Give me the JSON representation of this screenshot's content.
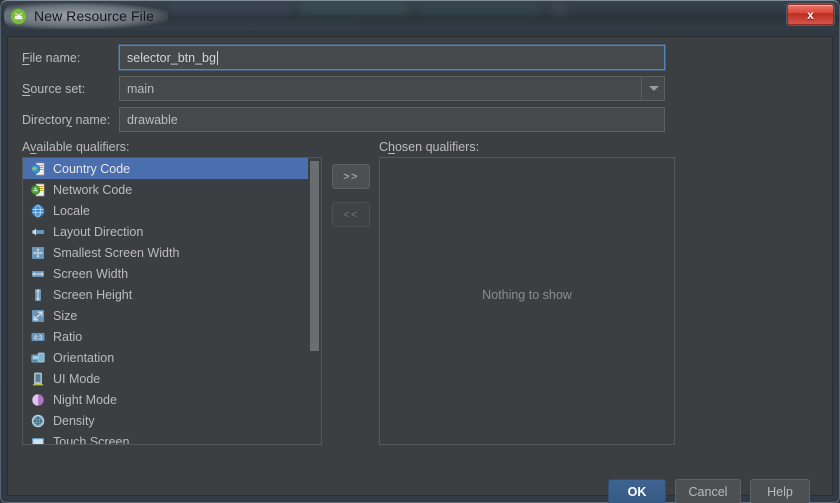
{
  "window": {
    "title": "New Resource File",
    "app_icon": "android-studio-icon",
    "close_label": "x"
  },
  "form": {
    "file_name": {
      "label": "File name:",
      "mnemonic": "F",
      "value": "selector_btn_bg",
      "placeholder": ""
    },
    "source_set": {
      "label": "Source set:",
      "mnemonic": "S",
      "value": "main",
      "options": [
        "main"
      ]
    },
    "directory_name": {
      "label": "Directory name:",
      "mnemonic": "y",
      "value": "drawable",
      "placeholder": ""
    }
  },
  "available": {
    "label": "Available qualifiers:",
    "mnemonic": "v",
    "items": [
      {
        "label": "Country Code",
        "icon": "country-code-icon",
        "selected": true
      },
      {
        "label": "Network Code",
        "icon": "network-code-icon",
        "selected": false
      },
      {
        "label": "Locale",
        "icon": "locale-globe-icon",
        "selected": false
      },
      {
        "label": "Layout Direction",
        "icon": "layout-direction-icon",
        "selected": false
      },
      {
        "label": "Smallest Screen Width",
        "icon": "smallest-screen-width-icon",
        "selected": false
      },
      {
        "label": "Screen Width",
        "icon": "screen-width-icon",
        "selected": false
      },
      {
        "label": "Screen Height",
        "icon": "screen-height-icon",
        "selected": false
      },
      {
        "label": "Size",
        "icon": "size-icon",
        "selected": false
      },
      {
        "label": "Ratio",
        "icon": "ratio-icon",
        "selected": false
      },
      {
        "label": "Orientation",
        "icon": "orientation-icon",
        "selected": false
      },
      {
        "label": "UI Mode",
        "icon": "ui-mode-icon",
        "selected": false
      },
      {
        "label": "Night Mode",
        "icon": "night-mode-icon",
        "selected": false
      },
      {
        "label": "Density",
        "icon": "density-icon",
        "selected": false
      },
      {
        "label": "Touch Screen",
        "icon": "touch-screen-icon",
        "selected": false
      }
    ]
  },
  "chosen": {
    "label": "Chosen qualifiers:",
    "mnemonic": "h",
    "empty_text": "Nothing to show",
    "items": []
  },
  "move_buttons": {
    "add_label": ">>",
    "remove_label": "<<"
  },
  "actions": {
    "ok": "OK",
    "cancel": "Cancel",
    "help": "Help"
  },
  "colors": {
    "accent_selection": "#4b6eaf",
    "focus_border": "#4b87c4",
    "dialog_bg": "#3c3f41",
    "field_bg": "#45494a",
    "text": "#bbbbbb",
    "close_red": "#d9483b"
  }
}
